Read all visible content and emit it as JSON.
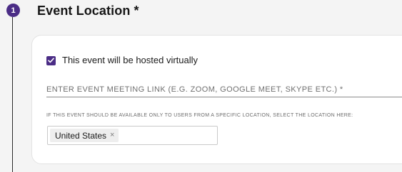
{
  "step": {
    "number": "1",
    "title": "Event Location *"
  },
  "virtual_event": {
    "checked": true,
    "label": "This event will be hosted virtually"
  },
  "meeting_link": {
    "value": "",
    "placeholder": "ENTER EVENT MEETING LINK (E.G. ZOOM, GOOGLE MEET, SKYPE ETC.) *"
  },
  "location_restriction": {
    "hint": "IF THIS EVENT SHOULD BE AVAILABLE ONLY TO USERS FROM A SPECIFIC LOCATION, SELECT THE LOCATION HERE:",
    "selected_tags": [
      {
        "label": "United States",
        "remove_glyph": "×"
      }
    ]
  },
  "colors": {
    "accent": "#4b2d86",
    "background": "#f4f4f4",
    "card": "#ffffff"
  },
  "icons": {
    "checkbox": "check-icon",
    "tag_remove": "close-icon"
  }
}
